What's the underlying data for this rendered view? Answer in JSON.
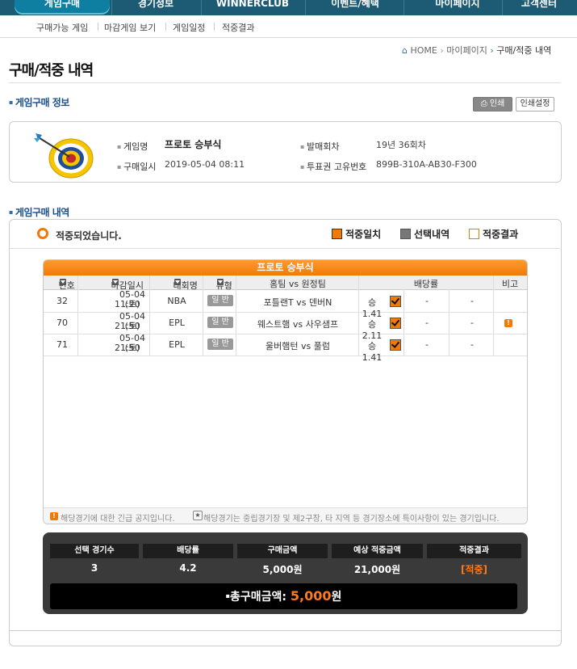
{
  "topnav": {
    "tabs": [
      {
        "label": "게임구매",
        "active": true
      },
      {
        "label": "경기정보"
      },
      {
        "label": "WINNERCLUB"
      },
      {
        "label": "이벤트/혜택"
      },
      {
        "label": "마이페이지"
      },
      {
        "label": "고객센터"
      }
    ]
  },
  "subnav": {
    "items": [
      "구매가능 게임",
      "마감게임 보기",
      "게임일정",
      "적중결과"
    ]
  },
  "breadcrumb": {
    "home": "HOME",
    "mypage": "마이페이지",
    "current": "구매/적중 내역"
  },
  "page_title": "구매/적중 내역",
  "purchase_info": {
    "section_title": "게임구매 정보",
    "print_label": "인쇄",
    "print_settings_label": "인쇄설정",
    "game_name_label": "게임명",
    "game_name": "프로토 승부식",
    "purchase_date_label": "구매일시",
    "purchase_date": "2019-05-04 08:11",
    "round_label": "발매회차",
    "round": "19년 36회차",
    "ticket_id_label": "투표권 고유번호",
    "ticket_id": "899B-310A-AB30-F300"
  },
  "purchase_history": {
    "section_title": "게임구매 내역",
    "status": "적중되었습니다.",
    "legend": [
      "적중일치",
      "선택내역",
      "적중결과"
    ],
    "table_title": "프로토 승부식",
    "columns": [
      "번호",
      "마감일시",
      "대회명",
      "유형",
      "홈팀 vs 원정팀",
      "배당률",
      "비고"
    ],
    "rows": [
      {
        "no": "32",
        "date": "05-04 (토)",
        "time": "11:20",
        "league": "NBA",
        "type": "일 반",
        "match": "포틀랜T vs 덴버N",
        "odds_win": "승1.41",
        "odds_draw": "-",
        "odds_lose": "-",
        "note": ""
      },
      {
        "no": "70",
        "date": "05-04 (토)",
        "time": "21:50",
        "league": "EPL",
        "type": "일 반",
        "match": "웨스트햄 vs 사우샘프",
        "odds_win": "승2.11",
        "odds_draw": "-",
        "odds_lose": "-",
        "note": "!"
      },
      {
        "no": "71",
        "date": "05-04 (토)",
        "time": "21:50",
        "league": "EPL",
        "type": "일 반",
        "match": "울버햄턴 vs 풀럼",
        "odds_win": "승1.41",
        "odds_draw": "-",
        "odds_lose": "-",
        "note": ""
      }
    ],
    "notice_1": "해당경기에 대한 긴급 공지입니다.",
    "notice_2": "해당경기는 중립경기장 및 제2구장, 타 지역 등 경기장소에 특이사항이 있는 경기입니다."
  },
  "summary": {
    "headers": [
      "선택 경기수",
      "배당률",
      "구매금액",
      "예상 적중금액",
      "적중결과"
    ],
    "values": [
      "3",
      "4.2",
      "5,000원",
      "21,000원",
      "[적중]"
    ],
    "total_label": "총구매금액:",
    "total_amount": "5,000",
    "total_unit": "원"
  },
  "colors": {
    "accent": "#f07a08",
    "nav": "#1d5a73",
    "section": "#1a4f8a"
  }
}
